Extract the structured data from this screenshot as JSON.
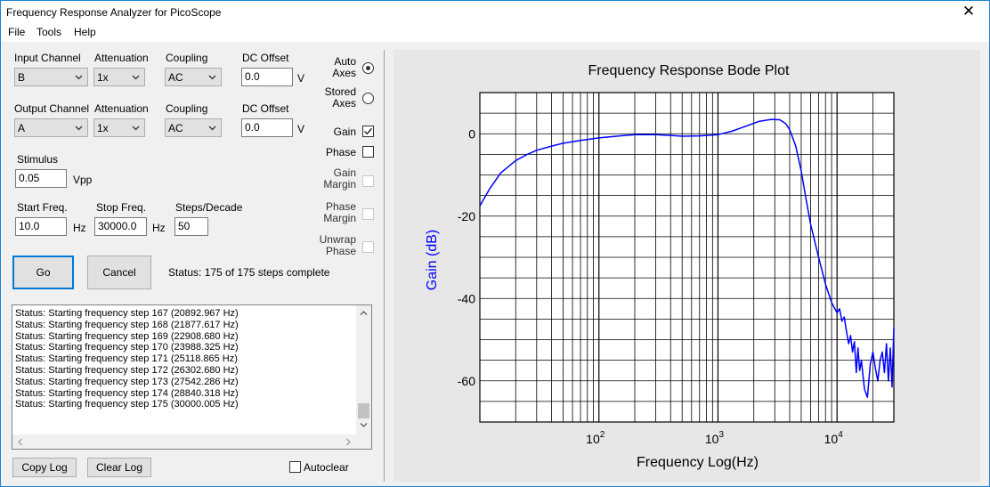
{
  "window": {
    "title": "Frequency Response Analyzer for PicoScope",
    "close_glyph": "✕"
  },
  "menu": {
    "file": "File",
    "tools": "Tools",
    "help": "Help"
  },
  "input": {
    "channel_label": "Input Channel",
    "channel_value": "B",
    "attenuation_label": "Attenuation",
    "attenuation_value": "1x",
    "coupling_label": "Coupling",
    "coupling_value": "AC",
    "dc_offset_label": "DC Offset",
    "dc_offset_value": "0.0",
    "dc_offset_unit": "V"
  },
  "output": {
    "channel_label": "Output Channel",
    "channel_value": "A",
    "attenuation_label": "Attenuation",
    "attenuation_value": "1x",
    "coupling_label": "Coupling",
    "coupling_value": "AC",
    "dc_offset_label": "DC Offset",
    "dc_offset_value": "0.0",
    "dc_offset_unit": "V"
  },
  "stimulus": {
    "label": "Stimulus",
    "value": "0.05",
    "unit": "Vpp"
  },
  "sweep": {
    "start_label": "Start Freq.",
    "start_value": "10.0",
    "start_unit": "Hz",
    "stop_label": "Stop Freq.",
    "stop_value": "30000.0",
    "stop_unit": "Hz",
    "steps_label": "Steps/Decade",
    "steps_value": "50"
  },
  "actions": {
    "go": "Go",
    "cancel": "Cancel",
    "status": "Status:  175 of 175 steps complete"
  },
  "options": {
    "auto_axes_1": "Auto",
    "auto_axes_2": "Axes",
    "stored_axes_1": "Stored",
    "stored_axes_2": "Axes",
    "gain": "Gain",
    "phase": "Phase",
    "gain_margin_1": "Gain",
    "gain_margin_2": "Margin",
    "phase_margin_1": "Phase",
    "phase_margin_2": "Margin",
    "unwrap_phase_1": "Unwrap",
    "unwrap_phase_2": "Phase",
    "auto_axes_selected": true,
    "gain_checked": true
  },
  "log": {
    "lines": [
      "Status: Starting frequency step 167 (20892.967 Hz)",
      "Status: Starting frequency step 168 (21877.617 Hz)",
      "Status: Starting frequency step 169 (22908.680 Hz)",
      "Status: Starting frequency step 170 (23988.325 Hz)",
      "Status: Starting frequency step 171 (25118.865 Hz)",
      "Status: Starting frequency step 172 (26302.680 Hz)",
      "Status: Starting frequency step 173 (27542.286 Hz)",
      "Status: Starting frequency step 174 (28840.318 Hz)",
      "Status: Starting frequency step 175 (30000.005 Hz)"
    ],
    "copy": "Copy Log",
    "clear": "Clear Log",
    "autoclear": "Autoclear"
  },
  "colors": {
    "gain_line": "#0000ff",
    "accent": "#0078d7"
  },
  "chart_data": {
    "type": "line",
    "title": "Frequency Response Bode Plot",
    "xlabel": "Frequency Log(Hz)",
    "ylabel": "Gain (dB)",
    "x_scale": "log",
    "xlim": [
      10,
      30000
    ],
    "ylim": [
      -70,
      10
    ],
    "grid": true,
    "x_tick_labels": [
      "10^2",
      "10^3",
      "10^4"
    ],
    "y_tick_labels": [
      "0",
      "-20",
      "-40",
      "-60"
    ],
    "series": [
      {
        "color": "#0000ff",
        "x": [
          10,
          12,
          15,
          20,
          25,
          30,
          40,
          50,
          70,
          100,
          150,
          200,
          300,
          400,
          500,
          700,
          1000,
          1300,
          1700,
          2200,
          2800,
          3300,
          3700,
          4000,
          4500,
          5000,
          5500,
          6000,
          7000,
          8000,
          9000,
          10000,
          10500,
          11000,
          11500,
          12000,
          12500,
          13000,
          13500,
          14000,
          14500,
          15000,
          15500,
          16000,
          17000,
          18000,
          19000,
          20000,
          21000,
          22000,
          23000,
          24000,
          25000,
          26000,
          27000,
          28000,
          29000,
          30000
        ],
        "y": [
          -17.5,
          -13.5,
          -9.5,
          -6.5,
          -5.0,
          -4.0,
          -3.0,
          -2.3,
          -1.6,
          -1.0,
          -0.5,
          -0.2,
          -0.2,
          -0.4,
          -0.6,
          -0.5,
          -0.2,
          0.6,
          1.8,
          3.0,
          3.5,
          3.4,
          2.5,
          1.0,
          -3.0,
          -9.0,
          -16.0,
          -22.0,
          -30.0,
          -36.5,
          -41.0,
          -43.5,
          -42.5,
          -45.5,
          -44.5,
          -48.0,
          -51.0,
          -49.0,
          -53.0,
          -50.5,
          -58.0,
          -52.0,
          -57.5,
          -55.0,
          -62.0,
          -64.0,
          -56.0,
          -53.0,
          -57.0,
          -60.0,
          -55.0,
          -53.0,
          -58.0,
          -51.0,
          -60.0,
          -52.0,
          -61.5,
          -47.0
        ]
      }
    ]
  }
}
